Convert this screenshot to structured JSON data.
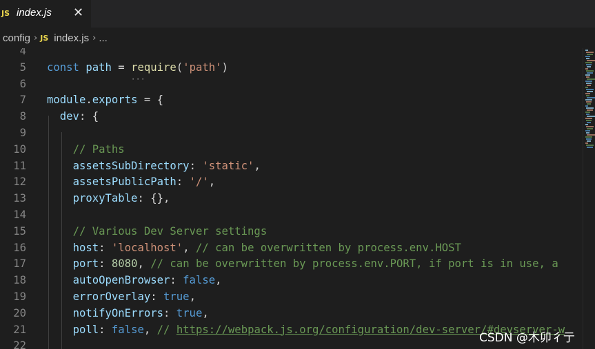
{
  "tab": {
    "badge": "JS",
    "label": "index.js",
    "close_glyph": "✕"
  },
  "breadcrumb": {
    "folder": "config",
    "separator": "›",
    "badge": "JS",
    "file": "index.js",
    "more": "..."
  },
  "editor": {
    "lines": [
      {
        "number": "4",
        "tokens": []
      },
      {
        "number": "5",
        "tokens": [
          {
            "t": "const",
            "c": "kw"
          },
          {
            "t": " ",
            "c": "pl"
          },
          {
            "t": "path",
            "c": "var"
          },
          {
            "t": " = ",
            "c": "pl"
          },
          {
            "t": "require",
            "c": "fn"
          },
          {
            "t": "(",
            "c": "pl"
          },
          {
            "t": "'path'",
            "c": "str"
          },
          {
            "t": ")",
            "c": "pl"
          }
        ]
      },
      {
        "number": "6",
        "tokens": []
      },
      {
        "number": "7",
        "tokens": [
          {
            "t": "module",
            "c": "var"
          },
          {
            "t": ".",
            "c": "pl"
          },
          {
            "t": "exports",
            "c": "var"
          },
          {
            "t": " = {",
            "c": "pl"
          }
        ]
      },
      {
        "number": "8",
        "tokens": [
          {
            "t": "  ",
            "c": "pl"
          },
          {
            "t": "dev",
            "c": "var"
          },
          {
            "t": ": {",
            "c": "pl"
          }
        ]
      },
      {
        "number": "9",
        "tokens": []
      },
      {
        "number": "10",
        "tokens": [
          {
            "t": "    ",
            "c": "pl"
          },
          {
            "t": "// Paths",
            "c": "cmt"
          }
        ]
      },
      {
        "number": "11",
        "tokens": [
          {
            "t": "    ",
            "c": "pl"
          },
          {
            "t": "assetsSubDirectory",
            "c": "var"
          },
          {
            "t": ": ",
            "c": "pl"
          },
          {
            "t": "'static'",
            "c": "str"
          },
          {
            "t": ",",
            "c": "pl"
          }
        ]
      },
      {
        "number": "12",
        "tokens": [
          {
            "t": "    ",
            "c": "pl"
          },
          {
            "t": "assetsPublicPath",
            "c": "var"
          },
          {
            "t": ": ",
            "c": "pl"
          },
          {
            "t": "'/'",
            "c": "str"
          },
          {
            "t": ",",
            "c": "pl"
          }
        ]
      },
      {
        "number": "13",
        "tokens": [
          {
            "t": "    ",
            "c": "pl"
          },
          {
            "t": "proxyTable",
            "c": "var"
          },
          {
            "t": ": {},",
            "c": "pl"
          }
        ]
      },
      {
        "number": "14",
        "tokens": []
      },
      {
        "number": "15",
        "tokens": [
          {
            "t": "    ",
            "c": "pl"
          },
          {
            "t": "// Various Dev Server settings",
            "c": "cmt"
          }
        ]
      },
      {
        "number": "16",
        "tokens": [
          {
            "t": "    ",
            "c": "pl"
          },
          {
            "t": "host",
            "c": "var"
          },
          {
            "t": ": ",
            "c": "pl"
          },
          {
            "t": "'localhost'",
            "c": "str"
          },
          {
            "t": ", ",
            "c": "pl"
          },
          {
            "t": "// can be overwritten by process.env.HOST",
            "c": "cmt"
          }
        ]
      },
      {
        "number": "17",
        "tokens": [
          {
            "t": "    ",
            "c": "pl"
          },
          {
            "t": "port",
            "c": "var"
          },
          {
            "t": ": ",
            "c": "pl"
          },
          {
            "t": "8080",
            "c": "num"
          },
          {
            "t": ", ",
            "c": "pl"
          },
          {
            "t": "// can be overwritten by process.env.PORT, if port is in use, a",
            "c": "cmt"
          }
        ]
      },
      {
        "number": "18",
        "tokens": [
          {
            "t": "    ",
            "c": "pl"
          },
          {
            "t": "autoOpenBrowser",
            "c": "var"
          },
          {
            "t": ": ",
            "c": "pl"
          },
          {
            "t": "false",
            "c": "kw"
          },
          {
            "t": ",",
            "c": "pl"
          }
        ]
      },
      {
        "number": "19",
        "tokens": [
          {
            "t": "    ",
            "c": "pl"
          },
          {
            "t": "errorOverlay",
            "c": "var"
          },
          {
            "t": ": ",
            "c": "pl"
          },
          {
            "t": "true",
            "c": "kw"
          },
          {
            "t": ",",
            "c": "pl"
          }
        ]
      },
      {
        "number": "20",
        "tokens": [
          {
            "t": "    ",
            "c": "pl"
          },
          {
            "t": "notifyOnErrors",
            "c": "var"
          },
          {
            "t": ": ",
            "c": "pl"
          },
          {
            "t": "true",
            "c": "kw"
          },
          {
            "t": ",",
            "c": "pl"
          }
        ]
      },
      {
        "number": "21",
        "tokens": [
          {
            "t": "    ",
            "c": "pl"
          },
          {
            "t": "poll",
            "c": "var"
          },
          {
            "t": ": ",
            "c": "pl"
          },
          {
            "t": "false",
            "c": "kw"
          },
          {
            "t": ", ",
            "c": "pl"
          },
          {
            "t": "// ",
            "c": "cmt"
          },
          {
            "t": "https://webpack.js.org/configuration/dev-server/#devserver-w",
            "c": "link"
          }
        ]
      },
      {
        "number": "22",
        "tokens": []
      }
    ]
  },
  "watermark": "CSDN @木卯彳亍",
  "colors": {
    "keyword": "#569cd6",
    "variable": "#9cdcfe",
    "function": "#dcdcaa",
    "string": "#ce9178",
    "number": "#b5cea8",
    "comment": "#6a9955",
    "js_badge": "#e8d44d"
  }
}
